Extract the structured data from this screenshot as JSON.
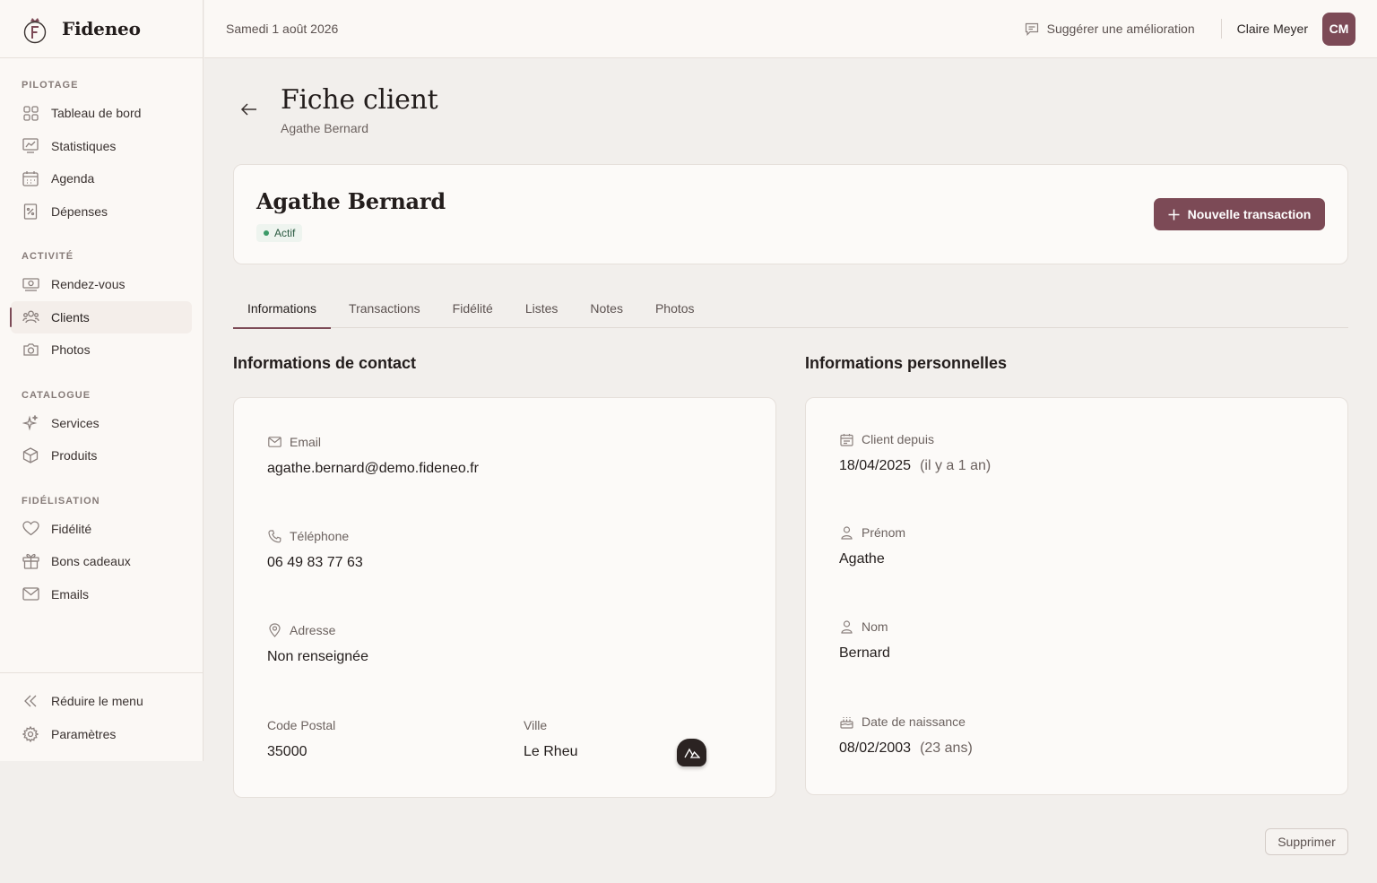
{
  "app": {
    "name": "Fideneo"
  },
  "sidebar": {
    "sections": [
      {
        "label": "PILOTAGE",
        "items": [
          {
            "label": "Tableau de bord",
            "icon": "grid-icon"
          },
          {
            "label": "Statistiques",
            "icon": "chart-icon"
          },
          {
            "label": "Agenda",
            "icon": "calendar-icon"
          },
          {
            "label": "Dépenses",
            "icon": "receipt-icon"
          }
        ]
      },
      {
        "label": "ACTIVITÉ",
        "items": [
          {
            "label": "Rendez-vous",
            "icon": "cash-icon"
          },
          {
            "label": "Clients",
            "icon": "users-icon",
            "active": true
          },
          {
            "label": "Photos",
            "icon": "camera-icon"
          }
        ]
      },
      {
        "label": "CATALOGUE",
        "items": [
          {
            "label": "Services",
            "icon": "sparkles-icon"
          },
          {
            "label": "Produits",
            "icon": "box-icon"
          }
        ]
      },
      {
        "label": "FIDÉLISATION",
        "items": [
          {
            "label": "Fidélité",
            "icon": "heart-icon"
          },
          {
            "label": "Bons cadeaux",
            "icon": "gift-icon"
          },
          {
            "label": "Emails",
            "icon": "mail-icon"
          }
        ]
      }
    ],
    "bottom": {
      "collapse_label": "Réduire le menu",
      "settings_label": "Paramètres"
    }
  },
  "topbar": {
    "date": "Samedi 1 août 2026",
    "suggest_label": "Suggérer une amélioration",
    "user_name": "Claire Meyer",
    "user_initials": "CM"
  },
  "page": {
    "title": "Fiche client",
    "subtitle": "Agathe Bernard"
  },
  "client": {
    "name": "Agathe Bernard",
    "status": "Actif",
    "new_transaction_label": "Nouvelle transaction"
  },
  "tabs": [
    {
      "label": "Informations",
      "active": true
    },
    {
      "label": "Transactions"
    },
    {
      "label": "Fidélité"
    },
    {
      "label": "Listes"
    },
    {
      "label": "Notes"
    },
    {
      "label": "Photos"
    }
  ],
  "contact": {
    "title": "Informations de contact",
    "email_label": "Email",
    "email": "agathe.bernard@demo.fideneo.fr",
    "phone_label": "Téléphone",
    "phone": "06 49 83 77 63",
    "address_label": "Adresse",
    "address": "Non renseignée",
    "postal_label": "Code Postal",
    "postal": "35000",
    "city_label": "Ville",
    "city": "Le Rheu"
  },
  "personal": {
    "title": "Informations personnelles",
    "since_label": "Client depuis",
    "since": "18/04/2025",
    "since_rel": "(il y a 1 an)",
    "firstname_label": "Prénom",
    "firstname": "Agathe",
    "lastname_label": "Nom",
    "lastname": "Bernard",
    "birth_label": "Date de naissance",
    "birth": "08/02/2003",
    "birth_age": "(23 ans)"
  },
  "actions": {
    "delete_label": "Supprimer"
  },
  "colors": {
    "accent": "#7c4a56",
    "status": "#3c9a68"
  }
}
